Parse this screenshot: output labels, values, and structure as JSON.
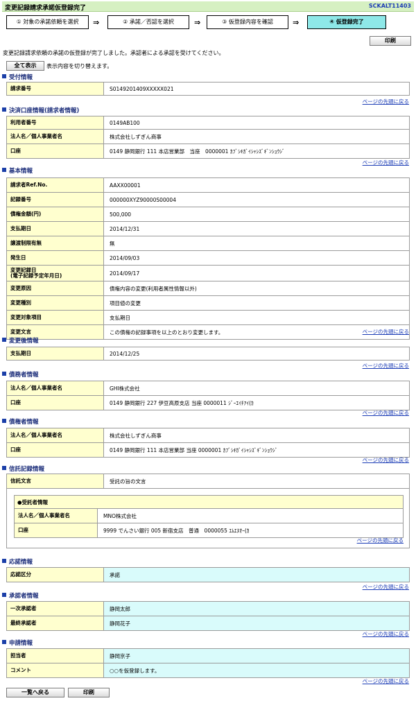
{
  "header": {
    "title": "変更記録請求承諾仮登録完了",
    "screen_id": "SCKALT11403"
  },
  "steps": [
    {
      "label": "① 対象の承諾依頼を選択"
    },
    {
      "label": "② 承諾／否認を選択"
    },
    {
      "label": "③ 仮登録内容を確認"
    },
    {
      "label": "④ 仮登録完了"
    }
  ],
  "arrow": "⇒",
  "buttons": {
    "print": "印刷",
    "show_all": "全て表示",
    "back_to_list": "一覧へ戻る"
  },
  "message": "変更記録請求依頼の承諾の仮登録が完了しました。承認者による承認を受けてください。",
  "show_all_note": "表示内容を切り替えます。",
  "page_top_link": "ページの先頭に戻る",
  "sections": {
    "receipt": {
      "title": "受付情報",
      "rows": [
        {
          "k": "請求番号",
          "v": "S0149201409XXXXX021"
        }
      ]
    },
    "settlement": {
      "title": "決済口座情報(請求者情報)",
      "rows": [
        {
          "k": "利用者番号",
          "v": "0149AB100"
        },
        {
          "k": "法人名／個人事業者名",
          "v": "株式会社しずぎん商事"
        },
        {
          "k": "口座",
          "v": "0149 静岡銀行 111 本店営業部　当座　0000001 ｶﾌﾞｼｷｶﾞｲｼｬｼｽﾞｷﾞﾝｼｮｳｼﾞ"
        }
      ]
    },
    "basic": {
      "title": "基本情報",
      "rows": [
        {
          "k": "請求者Ref.No.",
          "v": "AAXX00001"
        },
        {
          "k": "記録番号",
          "v": "000000XYZ90000S00004"
        },
        {
          "k": "債権金額(円)",
          "v": "500,000"
        },
        {
          "k": "支払期日",
          "v": "2014/12/31"
        },
        {
          "k": "譲渡制限有無",
          "v": "無"
        },
        {
          "k": "発生日",
          "v": "2014/09/03"
        },
        {
          "k": "変更記録日\n(電子記録予定年月日)",
          "v": "2014/09/17"
        },
        {
          "k": "変更原因",
          "v": "債権内容の変更(利用者属性情報以外)"
        },
        {
          "k": "変更種別",
          "v": "項目値の変更"
        },
        {
          "k": "変更対象項目",
          "v": "支払期日"
        },
        {
          "k": "変更文言",
          "v": "この債権の記録事項を以上のとおり変更します。"
        }
      ]
    },
    "after": {
      "title": "変更後情報",
      "rows": [
        {
          "k": "支払期日",
          "v": "2014/12/25"
        }
      ]
    },
    "debtor": {
      "title": "債務者情報",
      "rows": [
        {
          "k": "法人名／個人事業者名",
          "v": "GHI株式会社"
        },
        {
          "k": "口座",
          "v": "0149 静岡銀行 227 伊豆高原支店 当座 0000011 ｼﾞｰｴｲﾁｱｲ(ｶ"
        }
      ]
    },
    "creditor": {
      "title": "債権者情報",
      "rows": [
        {
          "k": "法人名／個人事業者名",
          "v": "株式会社しずぎん商事"
        },
        {
          "k": "口座",
          "v": "0149 静岡銀行 111 本店営業部 当座 0000001 ｶﾌﾞｼｷｶﾞｲｼｬｼｽﾞｷﾞﾝｼｮｳｼﾞ"
        }
      ]
    },
    "trust": {
      "title": "信託記録情報",
      "text_key": "信託文言",
      "text_val": "受託の旨の文言",
      "trustee_title": "●受託者情報",
      "trustee_rows": [
        {
          "k": "法人名／個人事業者名",
          "v": "MNO株式会社"
        },
        {
          "k": "口座",
          "v": "9999 でんさい銀行 005 新宿支店　普通　0000055 ｴﾑｴﾇｵｰ(ｶ"
        }
      ]
    },
    "response": {
      "title": "応諾情報",
      "rows": [
        {
          "k": "応諾区分",
          "v": "承諾"
        }
      ]
    },
    "approver": {
      "title": "承認者情報",
      "rows": [
        {
          "k": "一次承認者",
          "v": "静岡太郎"
        },
        {
          "k": "最終承認者",
          "v": "静岡花子"
        }
      ]
    },
    "application": {
      "title": "申請情報",
      "rows": [
        {
          "k": "担当者",
          "v": "静岡京子"
        },
        {
          "k": "コメント",
          "v": "○○を仮登録します。"
        }
      ]
    }
  },
  "colors": {
    "title_bg": "#d6f0c2",
    "key_bg": "#ffffcf",
    "active_step": "#8ee8e8",
    "cyan_row": "#d9fbfb",
    "link": "#1a3bb5"
  }
}
